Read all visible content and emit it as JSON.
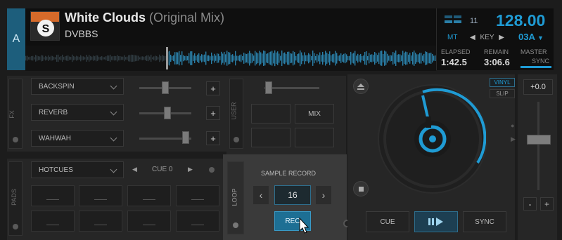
{
  "deck": {
    "letter": "A"
  },
  "track": {
    "title": "White Clouds",
    "mix": "(Original Mix)",
    "artist": "DVBBS",
    "art_icon": "spinnin-records-logo"
  },
  "info": {
    "bpm": "128.00",
    "pitch_count": "11",
    "mt_label": "MT",
    "key_label": "KEY",
    "key_value": "03A",
    "elapsed_label": "ELAPSED",
    "elapsed_value": "1:42.5",
    "remain_label": "REMAIN",
    "remain_value": "3:06.6",
    "master_label": "MASTER",
    "sync_label": "SYNC"
  },
  "fx": {
    "label": "FX",
    "effects": [
      {
        "name": "BACKSPIN",
        "level": 0.5
      },
      {
        "name": "REVERB",
        "level": 0.55
      },
      {
        "name": "WAHWAH",
        "level": 0.95
      }
    ],
    "plus_label": "+"
  },
  "user": {
    "label": "USER",
    "mix_label": "MIX"
  },
  "pads": {
    "label": "PADS",
    "mode": "HOTCUES",
    "cue_label": "CUE 0"
  },
  "sampler": {
    "loop_label": "LOOP",
    "title": "SAMPLE RECORD",
    "value": "16",
    "rec_label": "REC"
  },
  "transport": {
    "cue": "CUE",
    "sync": "SYNC"
  },
  "jog": {
    "vinyl": "VINYL",
    "slip": "SLIP"
  },
  "pitch": {
    "value": "+0.0",
    "minus": "-",
    "plus": "+"
  },
  "colors": {
    "accent": "#1f9bd4",
    "rec": "#1d6f94"
  }
}
